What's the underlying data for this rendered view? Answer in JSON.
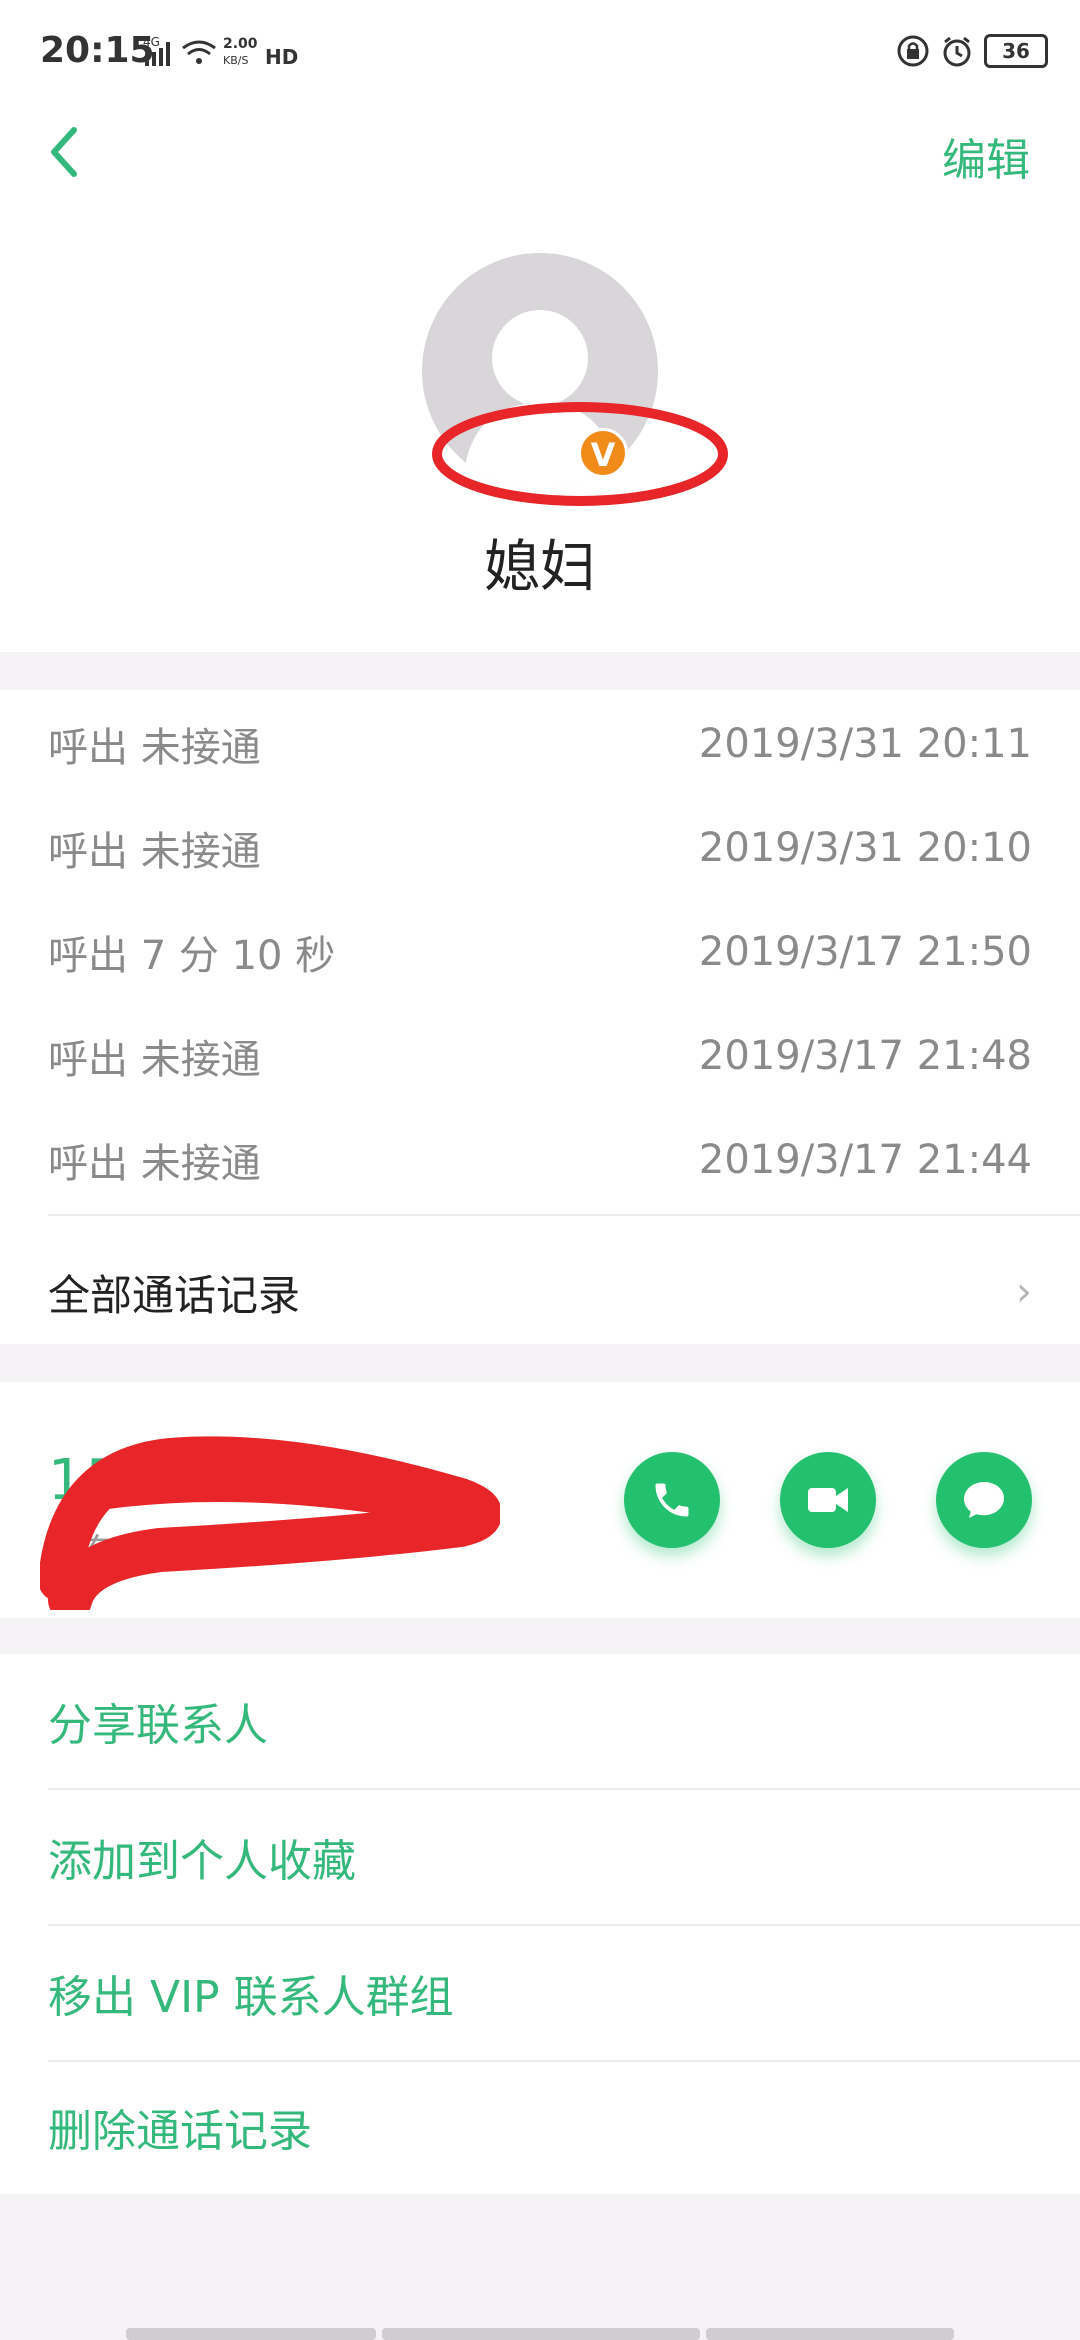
{
  "status_bar": {
    "time": "20:15",
    "net_speed": "2.00",
    "net_unit": "KB/S",
    "net_type": "4G",
    "hd": "HD",
    "battery": "36"
  },
  "header": {
    "back_icon": "chevron-left-icon",
    "edit_label": "编辑"
  },
  "contact": {
    "name": "媳妇",
    "vip_badge": "V"
  },
  "call_log": [
    {
      "type": "呼出 未接通",
      "time": "2019/3/31 20:11"
    },
    {
      "type": "呼出 未接通",
      "time": "2019/3/31 20:10"
    },
    {
      "type": "呼出 7 分 10 秒",
      "time": "2019/3/17 21:50"
    },
    {
      "type": "呼出 未接通",
      "time": "2019/3/17 21:48"
    },
    {
      "type": "呼出 未接通",
      "time": "2019/3/17 21:44"
    }
  ],
  "all_calls_label": "全部通话记录",
  "phone": {
    "number_visible": "15        6000",
    "location_visible": "山东临沂",
    "actions": [
      "phone-icon",
      "video-icon",
      "message-icon"
    ]
  },
  "actions": [
    "分享联系人",
    "添加到个人收藏",
    "移出 VIP 联系人群组",
    "删除通话记录"
  ],
  "colors": {
    "accent": "#35b87c",
    "action_green": "#23c16f",
    "vip_orange": "#f08a18",
    "redact_red": "#e8262a"
  }
}
